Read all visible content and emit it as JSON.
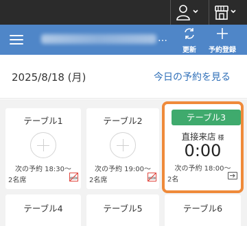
{
  "topbar": {
    "user_icon": "user-icon",
    "store_icon": "store-icon"
  },
  "header": {
    "title_blurred": "",
    "ellipsis": "…",
    "refresh_label": "更新",
    "add_label": "予約登録"
  },
  "date_bar": {
    "date": "2025/8/18 (月)",
    "today_link": "今日の予約を見る"
  },
  "tables": [
    {
      "name": "テーブル1",
      "next": "次の予約 18:30〜",
      "seats": "2名席",
      "smoking": "no-smoking-icon"
    },
    {
      "name": "テーブル2",
      "next": "次の予約 19:00〜",
      "seats": "2名席",
      "smoking": "no-smoking-icon"
    },
    {
      "name": "テーブル3",
      "status": "occupied",
      "guest": "直接来店",
      "honorific": "様",
      "elapsed": "0:00",
      "next": "次の予約 18:00〜",
      "seats": "2名",
      "action_icon": "checkout-icon"
    },
    {
      "name": "テーブル4"
    },
    {
      "name": "テーブル5"
    },
    {
      "name": "テーブル6"
    }
  ],
  "colors": {
    "header_blue": "#4f86c8",
    "topbar": "#2b2b2b",
    "occupied_green": "#3faa6d",
    "highlight_orange": "#ef8a3a",
    "link_blue": "#2f6fb8",
    "no_smoking_red": "#e0473f"
  }
}
